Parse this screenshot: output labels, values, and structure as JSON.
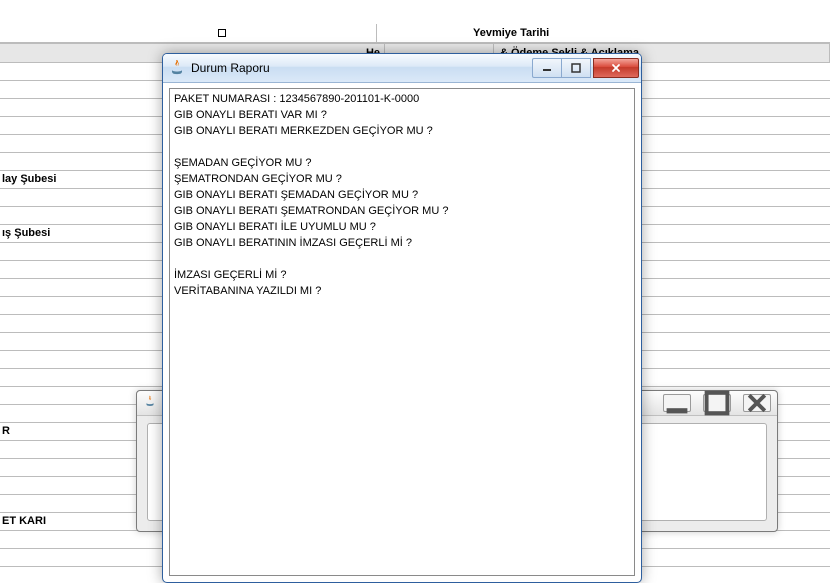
{
  "background": {
    "top_col2": "Yevmiye Tarihi",
    "header_col1": "He",
    "header_col3": "& Ödeme Şekli & Açıklama",
    "rows": [
      "",
      "",
      "",
      "",
      "",
      "",
      "lay Şubesi",
      "",
      "",
      "ış Şubesi",
      "",
      "",
      "",
      "",
      "",
      "",
      "",
      "",
      "",
      "",
      "R",
      "",
      "",
      "",
      "",
      "ET KARI",
      "",
      "",
      ""
    ]
  },
  "bg_dialog": {
    "title": ""
  },
  "dialog": {
    "title": "Durum Raporu",
    "content": "PAKET NUMARASI : 1234567890-201101-K-0000\nGIB ONAYLI BERATI VAR MI ?\nGIB ONAYLI BERATI MERKEZDEN GEÇİYOR MU ?\n\nŞEMADAN GEÇİYOR MU ?\nŞEMATRONDAN GEÇİYOR MU ?\nGIB ONAYLI BERATI ŞEMADAN GEÇİYOR MU ?\nGIB ONAYLI BERATI ŞEMATRONDAN GEÇİYOR MU ?\nGIB ONAYLI BERATI İLE UYUMLU MU ?\nGIB ONAYLI BERATININ İMZASI GEÇERLİ Mİ ?\n\nİMZASI GEÇERLİ Mİ ?\nVERİTABANINA YAZILDI MI ?"
  }
}
